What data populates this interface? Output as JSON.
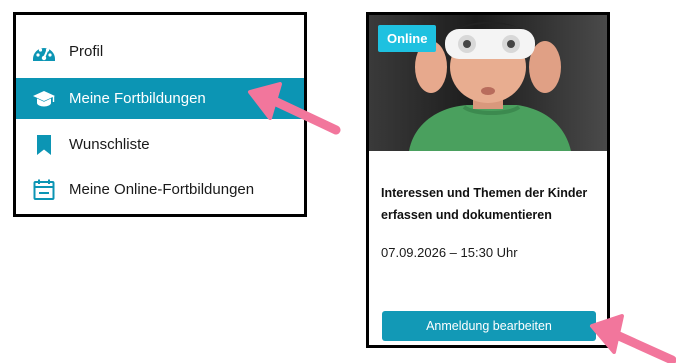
{
  "menu": {
    "items": [
      {
        "label": "Profil",
        "icon": "dashboard-gauge-icon",
        "active": false
      },
      {
        "label": "Meine Fortbildungen",
        "icon": "graduation-cap-icon",
        "active": true
      },
      {
        "label": "Wunschliste",
        "icon": "bookmark-icon",
        "active": false
      },
      {
        "label": "Meine Online-Fortbildungen",
        "icon": "calendar-icon",
        "active": false
      }
    ]
  },
  "card": {
    "badge": "Online",
    "title": "Interessen und Themen der Kinder erfassen und dokumentieren",
    "date": "07.09.2026 – 15:30 Uhr",
    "button_label": "Anmeldung bearbeiten"
  },
  "colors": {
    "active_bg": "#0c95b4",
    "icon": "#0c95b4",
    "badge_bg": "#1ec1e0",
    "button_bg": "#1299b6",
    "arrow": "#f2769c"
  }
}
